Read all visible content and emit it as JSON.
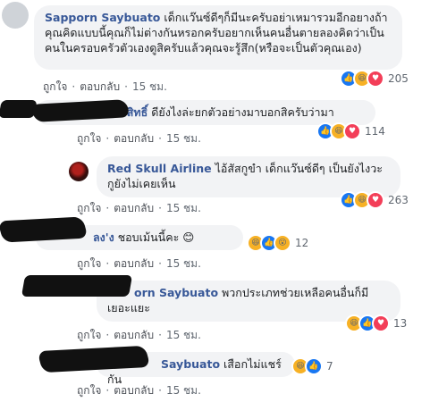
{
  "comments": [
    {
      "name": "Sapporn Saybuato",
      "text": "เด็กแว๊นซ์ดีๆก็มีนะครับอย่าเหมารวมอีกอยางถ้าคุณคิดแบบนี้คุณก็ไม่ต่างกันหรอกครับอยากเห็นคนอื่นตายลองคิดว่าเป็นคนในครอบครัวตัวเองดูสิครับแล้วคุณจะรู้สึก(หรือจะเป็นตัวคุณเอง)",
      "like": "ถูกใจ",
      "reply": "ตอบกลับ",
      "time": "15 ชม.",
      "reactions": [
        "like",
        "haha",
        "love"
      ],
      "count": "205"
    },
    {
      "name": "นหาสิทธิ์",
      "text": "ดียังไงล่ะยกตัวอย่างมาบอกสิครับว่ามา",
      "like": "ถูกใจ",
      "reply": "ตอบกลับ",
      "time": "15 ชม.",
      "reactions": [
        "like",
        "haha",
        "love"
      ],
      "count": "114"
    },
    {
      "name": "Red Skull Airline",
      "text": "ไอ้สัสกูขำ เด็กแว๊นซ์ดีๆ เป็นยังไงวะ กูยังไม่เคยเห็น",
      "like": "ถูกใจ",
      "reply": "ตอบกลับ",
      "time": "15 ชม.",
      "reactions": [
        "like",
        "haha",
        "love"
      ],
      "count": "263"
    },
    {
      "name": "ลง'ง",
      "text": "ชอบเม้นนี้คะ",
      "emoji": "😊",
      "like": "ถูกใจ",
      "reply": "ตอบกลับ",
      "time": "15 ชม.",
      "reactions": [
        "haha",
        "like",
        "wow"
      ],
      "count": "12"
    },
    {
      "name": "orn Saybuato",
      "text": "พวกประเภทช่วยเหลือคนอื่นก็มีเยอะแยะ",
      "like": "ถูกใจ",
      "reply": "ตอบกลับ",
      "time": "15 ชม.",
      "reactions": [
        "haha",
        "like",
        "love"
      ],
      "count": "13"
    },
    {
      "name": "Saybuato",
      "text": "เสือกไม่แชร์กัน",
      "like": "ถูกใจ",
      "reply": "ตอบกลับ",
      "time": "15 ชม.",
      "reactions": [
        "haha",
        "like"
      ],
      "count": "7"
    }
  ],
  "colors": {
    "name": "#385898",
    "bubble": "#f2f3f5",
    "like": "#1877f2",
    "love": "#f33e58",
    "haha": "#f7b125"
  }
}
